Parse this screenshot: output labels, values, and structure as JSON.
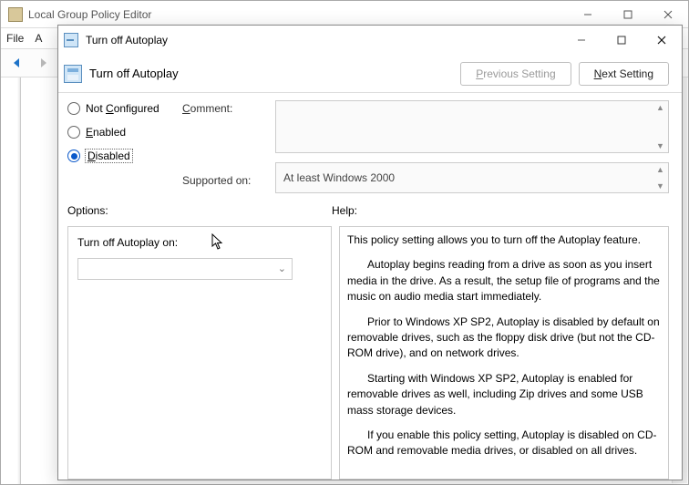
{
  "parent": {
    "title": "Local Group Policy Editor",
    "menu": {
      "file": "File",
      "action_prefix": "A"
    }
  },
  "dialog": {
    "title": "Turn off Autoplay",
    "header_title": "Turn off Autoplay",
    "prev_btn_p": "P",
    "prev_btn_rest": "revious Setting",
    "next_btn_n": "N",
    "next_btn_rest": "ext Setting",
    "radios": {
      "not_configured_c": "C",
      "not_configured_rest": "onfigured",
      "not_configured_pre": "Not ",
      "enabled_e": "E",
      "enabled_rest": "nabled",
      "disabled_d": "D",
      "disabled_rest": "isabled",
      "selected": "disabled"
    },
    "comment_label_c": "C",
    "comment_label_rest": "omment:",
    "supported_label": "Supported on:",
    "supported_value": "At least Windows 2000",
    "options_label": "Options:",
    "help_label": "Help:",
    "options_field_label": "Turn off Autoplay on:",
    "options_field_value": "",
    "help_paragraphs": {
      "p1": "This policy setting allows you to turn off the Autoplay feature.",
      "p2": "Autoplay begins reading from a drive as soon as you insert media in the drive. As a result, the setup file of programs and the music on audio media start immediately.",
      "p3": "Prior to Windows XP SP2, Autoplay is disabled by default on removable drives, such as the floppy disk drive (but not the CD-ROM drive), and on network drives.",
      "p4": "Starting with Windows XP SP2, Autoplay is enabled for removable drives as well, including Zip drives and some USB mass storage devices.",
      "p5": "If you enable this policy setting, Autoplay is disabled on CD-ROM and removable media drives, or disabled on all drives."
    }
  }
}
